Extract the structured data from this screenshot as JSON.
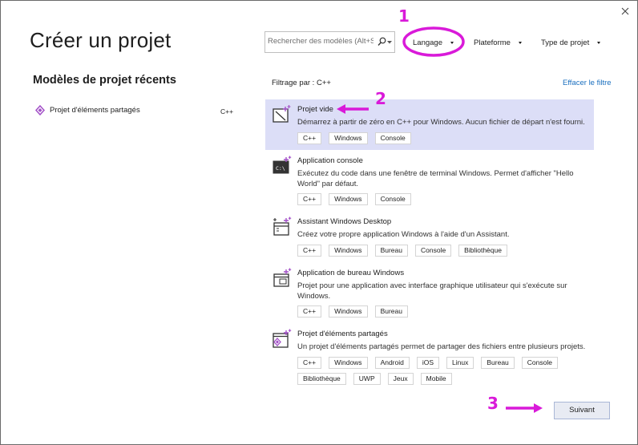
{
  "window": {
    "title": "Créer un projet",
    "close_icon": "close-icon"
  },
  "search": {
    "placeholder": "Rechercher des modèles (Alt+S)"
  },
  "filters": {
    "language_label": "Langage",
    "platform_label": "Plateforme",
    "project_type_label": "Type de projet",
    "applied_label": "Filtrage par : C++",
    "clear_label": "Effacer le filtre"
  },
  "recent": {
    "heading": "Modèles de projet récents",
    "items": [
      {
        "label": "Projet d'éléments partagés",
        "language": "C++",
        "icon": "shared-items-icon"
      }
    ]
  },
  "templates": [
    {
      "name": "Projet vide",
      "description": "Démarrez à partir de zéro en C++ pour Windows. Aucun fichier de départ n'est fourni.",
      "tags": [
        "C++",
        "Windows",
        "Console"
      ],
      "icon": "empty-project-icon",
      "selected": true
    },
    {
      "name": "Application console",
      "description": "Exécutez du code dans une fenêtre de terminal Windows. Permet d'afficher \"Hello World\" par défaut.",
      "tags": [
        "C++",
        "Windows",
        "Console"
      ],
      "icon": "console-app-icon",
      "selected": false
    },
    {
      "name": "Assistant Windows Desktop",
      "description": "Créez votre propre application Windows à l'aide d'un Assistant.",
      "tags": [
        "C++",
        "Windows",
        "Bureau",
        "Console",
        "Bibliothèque"
      ],
      "icon": "desktop-wizard-icon",
      "selected": false
    },
    {
      "name": "Application de bureau Windows",
      "description": "Projet pour une application avec interface graphique utilisateur qui s'exécute sur Windows.",
      "tags": [
        "C++",
        "Windows",
        "Bureau"
      ],
      "icon": "desktop-app-icon",
      "selected": false
    },
    {
      "name": "Projet d'éléments partagés",
      "description": "Un projet d'éléments partagés permet de partager des fichiers entre plusieurs projets.",
      "tags": [
        "C++",
        "Windows",
        "Android",
        "iOS",
        "Linux",
        "Bureau",
        "Console",
        "Bibliothèque",
        "UWP",
        "Jeux",
        "Mobile"
      ],
      "icon": "shared-items-project-icon",
      "selected": false
    }
  ],
  "footer": {
    "next_label": "Suivant"
  },
  "annotations": {
    "step1": "1",
    "step2": "2",
    "step3": "3",
    "color": "#d91ad9"
  },
  "colors": {
    "accent_purple": "#a24fc7",
    "selection_bg": "#dcdef7",
    "link_blue": "#1a6fbf"
  }
}
